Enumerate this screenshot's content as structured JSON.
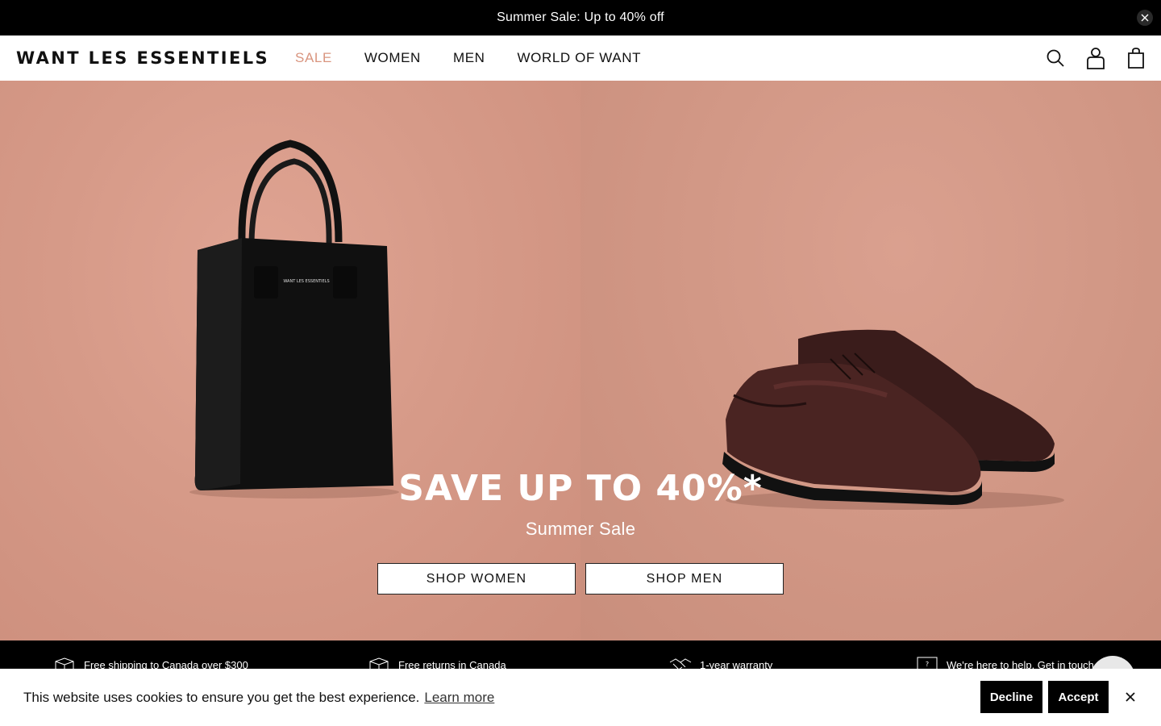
{
  "announcement": {
    "text": "Summer Sale: Up to 40% off",
    "close_icon": "close-icon"
  },
  "header": {
    "logo": "WANT LES ESSENTIELS",
    "nav": [
      {
        "label": "SALE",
        "accent": "#d9957f"
      },
      {
        "label": "WOMEN"
      },
      {
        "label": "MEN"
      },
      {
        "label": "WORLD OF WANT"
      }
    ],
    "icons": [
      "search-icon",
      "account-icon",
      "bag-icon"
    ]
  },
  "hero": {
    "title": "SAVE UP TO 40%*",
    "subtitle": "Summer Sale",
    "bag_brand": "WANT LES ESSENTIELS",
    "buttons": [
      {
        "label": "SHOP WOMEN"
      },
      {
        "label": "SHOP MEN"
      }
    ],
    "colors": {
      "left_bg": "#d69a88",
      "right_bg": "#d29886"
    }
  },
  "perks": [
    {
      "icon": "box-icon",
      "text": "Free shipping to Canada over $300"
    },
    {
      "icon": "return-box-icon",
      "text": "Free returns in Canada"
    },
    {
      "icon": "handshake-icon",
      "text": "1-year warranty"
    },
    {
      "icon": "help-icon",
      "text": "We're here to help. Get in touch"
    }
  ],
  "cookie": {
    "text": "This website uses cookies to ensure you get the best experience.",
    "link": "Learn more",
    "decline": "Decline",
    "accept": "Accept"
  }
}
